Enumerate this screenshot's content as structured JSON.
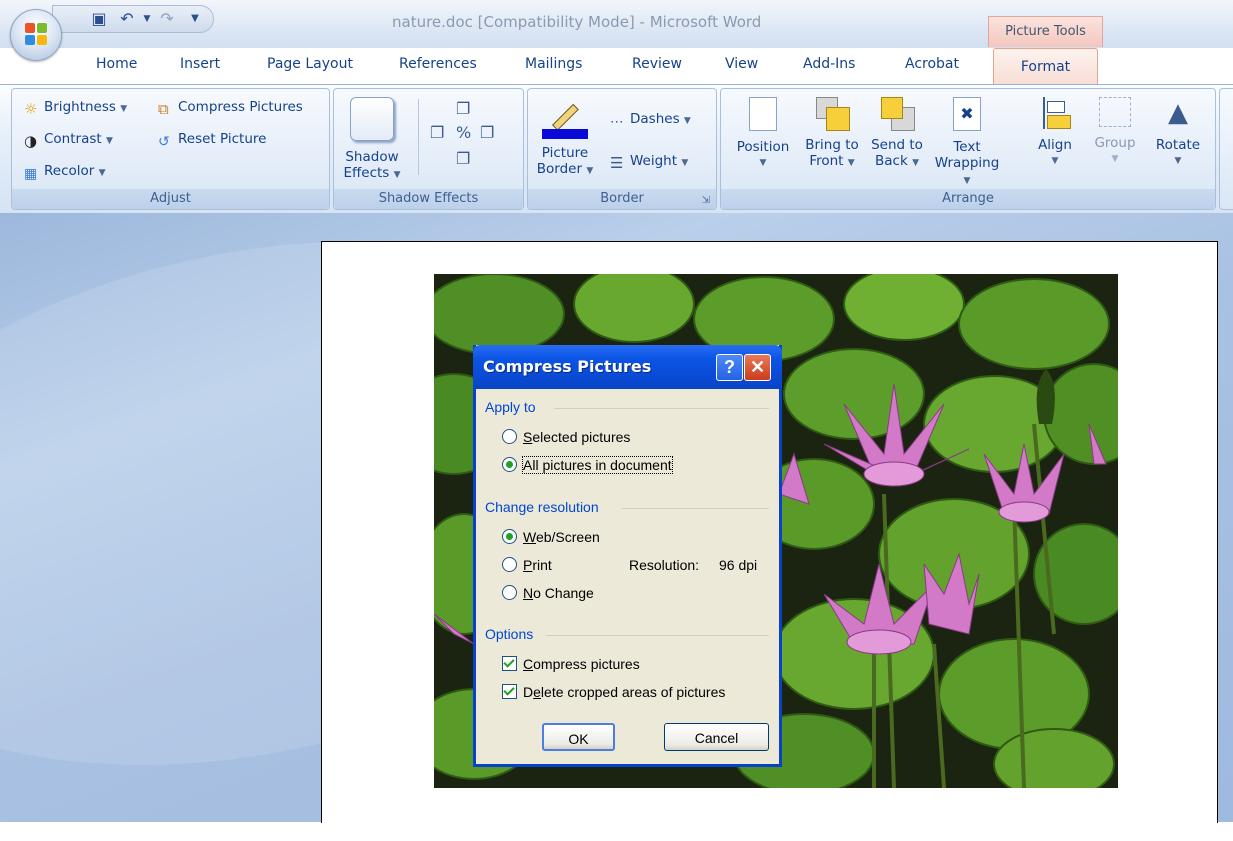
{
  "window": {
    "title": "nature.doc [Compatibility Mode] - Microsoft Word",
    "contextual_tab": "Picture Tools"
  },
  "tabs": [
    "Home",
    "Insert",
    "Page Layout",
    "References",
    "Mailings",
    "Review",
    "View",
    "Add-Ins",
    "Acrobat",
    "Format"
  ],
  "ribbon": {
    "adjust": {
      "brightness": "Brightness",
      "compress": "Compress Pictures",
      "contrast": "Contrast",
      "reset": "Reset Picture",
      "recolor": "Recolor",
      "label": "Adjust"
    },
    "shadow": {
      "effects_line1": "Shadow",
      "effects_line2": "Effects",
      "label": "Shadow Effects"
    },
    "border": {
      "picture_border_line1": "Picture",
      "picture_border_line2": "Border",
      "dashes": "Dashes",
      "weight": "Weight",
      "label": "Border"
    },
    "arrange": {
      "position": "Position",
      "bring_line1": "Bring to",
      "bring_line2": "Front",
      "send_line1": "Send to",
      "send_line2": "Back",
      "text_line1": "Text",
      "text_line2": "Wrapping",
      "align": "Align",
      "group": "Group",
      "rotate": "Rotate",
      "label": "Arrange"
    }
  },
  "dialog": {
    "title": "Compress Pictures",
    "help_glyph": "?",
    "close_glyph": "✕",
    "apply_to": {
      "heading": "Apply to",
      "selected_pictures": "elected pictures",
      "selected_key": "S",
      "all_pictures": "All pictures in document",
      "selected_option": "all"
    },
    "resolution": {
      "heading": "Change resolution",
      "web_key": "W",
      "web_rest": "eb/Screen",
      "print_key": "P",
      "print_rest": "rint",
      "no_change_key": "N",
      "no_change_rest": "o Change",
      "resolution_label": "Resolution:",
      "resolution_value": "96 dpi",
      "selected_option": "web"
    },
    "options": {
      "heading": "Options",
      "compress_key": "C",
      "compress_rest": "ompress pictures",
      "compress_checked": true,
      "delete_pre": "D",
      "delete_key": "e",
      "delete_rest": "lete cropped areas of pictures",
      "delete_checked": true
    },
    "ok": "OK",
    "cancel": "Cancel"
  },
  "colors": {
    "dialog_title_blue": "#0a4bd6",
    "border_swatch": "#0a0ad8",
    "contextual_tab": "#f3c7be"
  }
}
